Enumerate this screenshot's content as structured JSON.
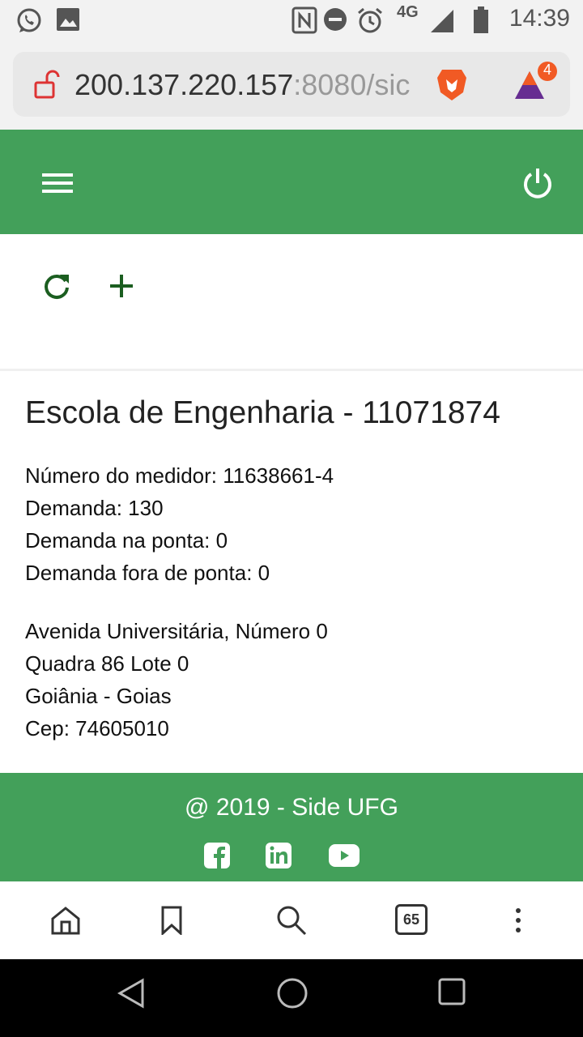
{
  "status_bar": {
    "time": "14:39",
    "network": "4G",
    "icons": [
      "whatsapp-icon",
      "image-icon",
      "nfc-icon",
      "do-not-disturb-icon",
      "alarm-icon",
      "signal-icon",
      "battery-icon"
    ]
  },
  "browser": {
    "url_host": "200.137.220.157",
    "url_rest": ":8080/sic",
    "tab_count": "65",
    "rewards_badge": "4",
    "icons": [
      "unlocked-icon",
      "brave-lion-icon",
      "brave-rewards-icon"
    ]
  },
  "header": {
    "icons": [
      "menu-icon",
      "power-icon"
    ],
    "color": "#43a05a"
  },
  "toolbar": {
    "icons": [
      "refresh-icon",
      "add-icon"
    ],
    "icon_color": "#1b5e20"
  },
  "site": {
    "title": "Escola de Engenharia - 11071874",
    "meter": "Número do medidor: 11638661-4",
    "demand": "Demanda: 130",
    "peak_demand": "Demanda na ponta: 0",
    "offpeak_demand": "Demanda fora de ponta: 0",
    "address_street": "Avenida Universitária, Número 0",
    "address_block": "Quadra 86 Lote 0",
    "address_city": "Goiânia - Goias",
    "address_cep": "Cep: 74605010"
  },
  "footer": {
    "copyright": "@ 2019 - Side UFG",
    "icons": [
      "facebook-icon",
      "linkedin-icon",
      "youtube-icon"
    ]
  },
  "browser_nav": {
    "icons": [
      "home-icon",
      "bookmark-icon",
      "search-icon",
      "tabs-icon",
      "more-icon"
    ]
  },
  "android_nav": {
    "icons": [
      "back-icon",
      "home-circle-icon",
      "recents-icon"
    ]
  }
}
